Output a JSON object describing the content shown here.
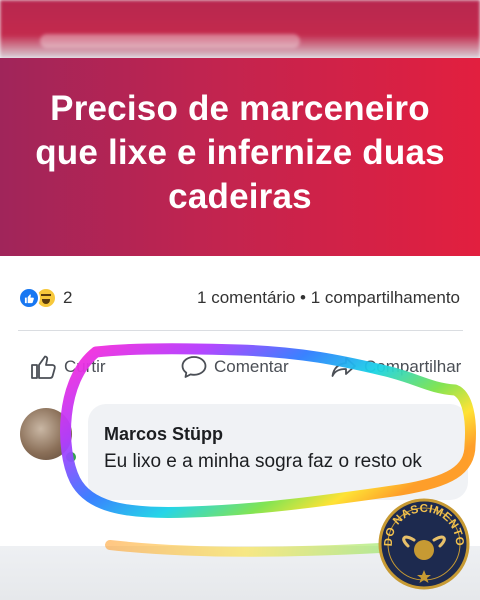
{
  "post": {
    "headline": "Preciso de marceneiro que lixe e infernize duas cadeiras"
  },
  "reactions": {
    "icons": [
      "like-icon",
      "haha-icon"
    ],
    "count": "2",
    "summary": "1 comentário • 1 compartilhamento"
  },
  "actions": {
    "like_label": "Curtir",
    "comment_label": "Comentar",
    "share_label": "Compartilhar"
  },
  "comment": {
    "author": "Marcos Stüpp",
    "text": "Eu lixo e a minha sogra faz o resto ok"
  },
  "watermark": {
    "text": "DO NASCIMENTO"
  },
  "colors": {
    "banner_start": "#a0255a",
    "banner_end": "#e21f3f",
    "facebook_blue": "#1877f2",
    "online_green": "#31a24c"
  }
}
